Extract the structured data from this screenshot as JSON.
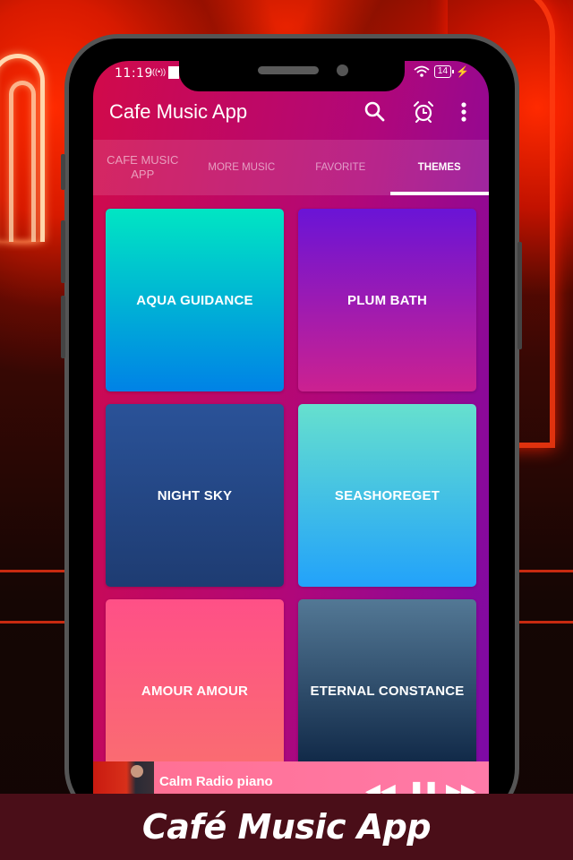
{
  "status_bar": {
    "time": "11:19",
    "battery": "14"
  },
  "app_bar": {
    "title": "Cafe Music App",
    "icons": [
      "search-icon",
      "alarm-icon",
      "more-vert-icon"
    ]
  },
  "tabs": [
    {
      "label": "CAFE MUSIC APP",
      "active": false
    },
    {
      "label": "MORE MUSIC",
      "active": false
    },
    {
      "label": "FAVORITE",
      "active": false
    },
    {
      "label": "THEMES",
      "active": true
    }
  ],
  "themes": [
    {
      "name": "AQUA GUIDANCE",
      "colors": [
        "#00e6c3",
        "#0082e6"
      ]
    },
    {
      "name": "PLUM BATH",
      "colors": [
        "#6a14d6",
        "#cc2190"
      ]
    },
    {
      "name": "NIGHT SKY",
      "colors": [
        "#2a5298",
        "#1e3c72"
      ]
    },
    {
      "name": "SEASHOREGET",
      "colors": [
        "#66e0ce",
        "#22a2fa"
      ]
    },
    {
      "name": "AMOUR AMOUR",
      "colors": [
        "#ff5087",
        "#f96f6f"
      ]
    },
    {
      "name": "ETERNAL CONSTANCE",
      "colors": [
        "#537895",
        "#09203f"
      ]
    }
  ],
  "player": {
    "title": "Calm Radio piano",
    "controls": [
      "rewind-icon",
      "pause-icon",
      "fast-forward-icon"
    ]
  },
  "banner": {
    "title": "Café Music App"
  }
}
